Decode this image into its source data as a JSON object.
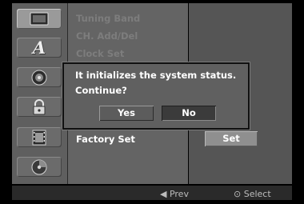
{
  "icon_menu": [
    {
      "name": "tv-icon"
    },
    {
      "name": "language-icon",
      "glyph": "A"
    },
    {
      "name": "speaker-icon"
    },
    {
      "name": "lock-icon"
    },
    {
      "name": "film-icon"
    },
    {
      "name": "disc-icon"
    }
  ],
  "menu": {
    "items": [
      "Tuning Band",
      "CH. Add/Del",
      "Clock Set",
      "",
      "",
      "",
      "",
      "Factory Set"
    ]
  },
  "panel": {
    "set_label": "Set"
  },
  "dialog": {
    "line1": "It initializes the system status.",
    "line2": "Continue?",
    "yes_label": "Yes",
    "no_label": "No"
  },
  "footer": {
    "prev_label": "◀ Prev",
    "select_label": "⊙ Select"
  }
}
